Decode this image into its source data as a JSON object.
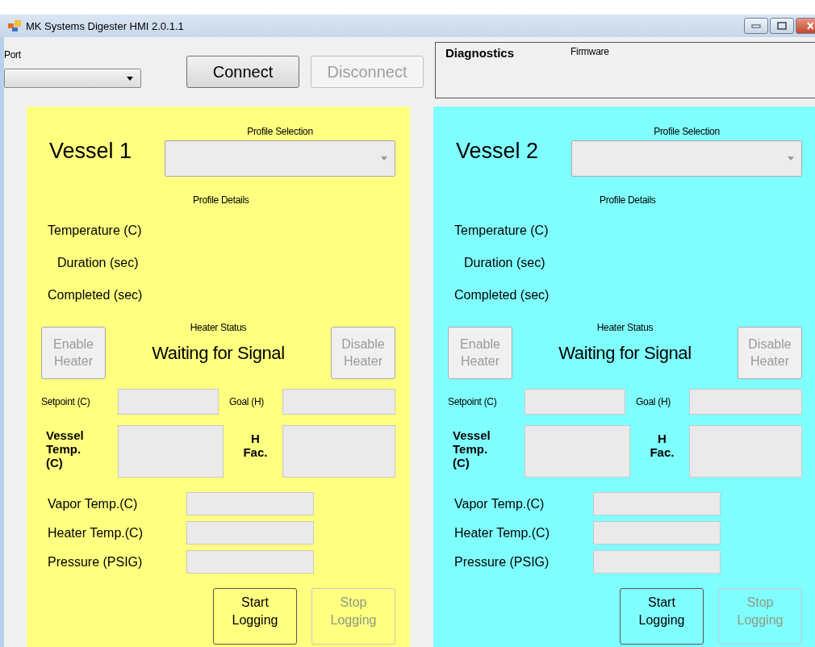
{
  "window": {
    "title": "MK Systems Digester HMI 2.0.1.1"
  },
  "toolbar": {
    "port_label": "Port",
    "buttons": [
      {
        "label": "Connect",
        "disabled": false
      },
      {
        "label": "Disconnect",
        "disabled": true
      }
    ]
  },
  "diagnostics": {
    "title": "Diagnostics",
    "firmware_label": "Firmware"
  },
  "vessels": [
    {
      "title": "Vessel 1",
      "color": "#ffff80",
      "profile_selection_label": "Profile Selection",
      "profile_details_label": "Profile Details",
      "details": [
        "Temperature (C)",
        "Duration (sec)",
        "Completed (sec)"
      ],
      "heater_status_label": "Heater Status",
      "heater_status": "Waiting for Signal",
      "enable_button": {
        "label": "Enable Heater",
        "disabled": true
      },
      "disable_button": {
        "label": "Disable Heater",
        "disabled": true
      },
      "setpoint_label": "Setpoint (C)",
      "goal_label": "Goal (H)",
      "vessel_temp_label": "Vessel Temp. (C)",
      "h_factor_label": "H Fac.",
      "readings": [
        "Vapor Temp.(C)",
        "Heater Temp.(C)",
        "Pressure (PSIG)"
      ],
      "start_button": {
        "label": "Start Logging",
        "disabled": false
      },
      "stop_button": {
        "label": "Stop Logging",
        "disabled": true
      }
    },
    {
      "title": "Vessel 2",
      "color": "#80ffff",
      "profile_selection_label": "Profile Selection",
      "profile_details_label": "Profile Details",
      "details": [
        "Temperature (C)",
        "Duration (sec)",
        "Completed (sec)"
      ],
      "heater_status_label": "Heater Status",
      "heater_status": "Waiting for Signal",
      "enable_button": {
        "label": "Enable Heater",
        "disabled": true
      },
      "disable_button": {
        "label": "Disable Heater",
        "disabled": true
      },
      "setpoint_label": "Setpoint (C)",
      "goal_label": "Goal (H)",
      "vessel_temp_label": "Vessel Temp. (C)",
      "h_factor_label": "H Fac.",
      "readings": [
        "Vapor Temp.(C)",
        "Heater Temp.(C)",
        "Pressure (PSIG)"
      ],
      "start_button": {
        "label": "Start Logging",
        "disabled": false
      },
      "stop_button": {
        "label": "Stop Logging",
        "disabled": true
      }
    }
  ]
}
